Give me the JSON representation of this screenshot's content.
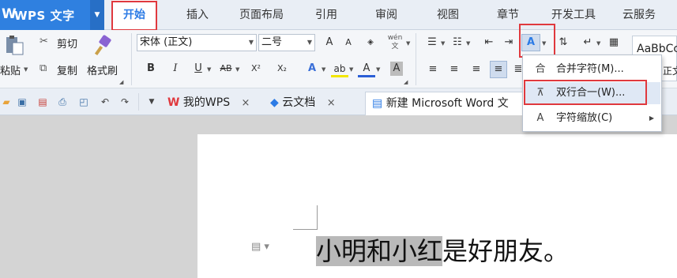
{
  "app": {
    "logo_glyph": "W",
    "name": "WPS 文字",
    "menu_arrow": "▼"
  },
  "tabs": [
    "开始",
    "插入",
    "页面布局",
    "引用",
    "审阅",
    "视图",
    "章节",
    "开发工具",
    "云服务"
  ],
  "ribbon": {
    "paste_label": "粘贴",
    "cut_label": "剪切",
    "copy_label": "复制",
    "format_painter_label": "格式刷",
    "font_name": "宋体 (正文)",
    "font_size": "二号",
    "grow_font": "A",
    "shrink_font": "A",
    "phonetic": "wén 文",
    "bold": "B",
    "italic": "I",
    "underline": "U",
    "strike": "AB",
    "superscript": "X²",
    "subscript": "X₂",
    "text_effect": "A",
    "highlight": "ab",
    "font_color": "A",
    "char_shading": "A",
    "style_preview": "AaBbCc",
    "style_sample": "正文"
  },
  "quickbar": {
    "tab_my_wps": "我的WPS",
    "tab_cloud_docs": "云文档",
    "tab_new_doc": "新建 Microsoft Word 文",
    "close": "×"
  },
  "menu": {
    "items": [
      {
        "icon": "合",
        "label": "合并字符(M)...",
        "has_sub": false
      },
      {
        "icon": "⊼",
        "label": "双行合一(W)...",
        "has_sub": false
      },
      {
        "icon": "A",
        "label": "字符缩放(C)",
        "has_sub": true
      }
    ]
  },
  "document": {
    "highlighted": "小明和小红",
    "rest": "是好朋友。"
  },
  "colors": {
    "accent": "#2c7be5",
    "app_blue": "#2f80e0",
    "annotation_red": "#e0393e",
    "selection_gray": "#b9b9b9"
  }
}
